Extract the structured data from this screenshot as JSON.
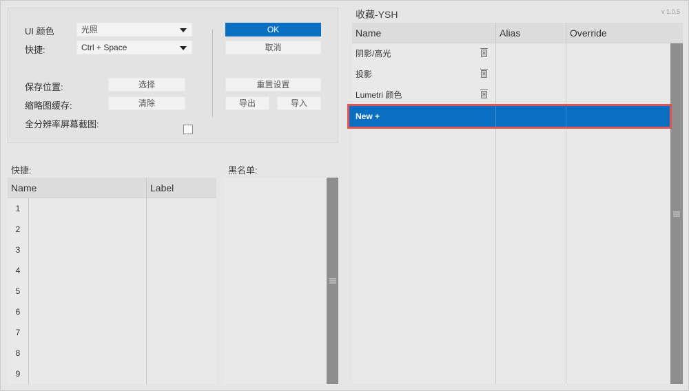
{
  "version": "v 1.0.5",
  "settings": {
    "ui_color_label": "UI 颜色",
    "ui_color_value": "光照",
    "shortcut_label": "快捷:",
    "shortcut_value": "Ctrl + Space",
    "save_location_label": "保存位置:",
    "thumbnail_cache_label": "缩略图缓存:",
    "fullres_label": "全分辨率屏幕截图:",
    "fullres_checked": false,
    "choose_button": "选择",
    "clear_button": "清除",
    "ok_button": "OK",
    "cancel_button": "取消",
    "reset_button": "重置设置",
    "export_button": "导出",
    "import_button": "导入"
  },
  "shortcuts": {
    "title": "快捷:",
    "columns": [
      "Name",
      "Label"
    ],
    "rows": [
      "1",
      "2",
      "3",
      "4",
      "5",
      "6",
      "7",
      "8",
      "9"
    ]
  },
  "blacklist": {
    "title": "黑名单:"
  },
  "favorites": {
    "title": "收藏-YSH",
    "columns": [
      "Name",
      "Alias",
      "Override"
    ],
    "items": [
      "阴影/高光",
      "投影",
      "Lumetri 颜色"
    ],
    "new_row_label": "New +"
  }
}
